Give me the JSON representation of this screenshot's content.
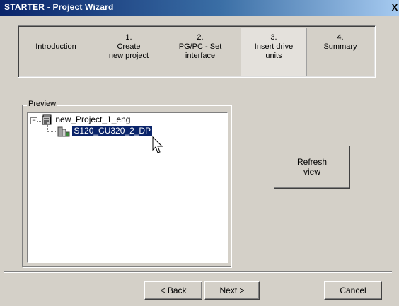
{
  "window": {
    "title": "STARTER - Project Wizard",
    "close_label": "X"
  },
  "steps": [
    {
      "number": "",
      "label": "Introduction"
    },
    {
      "number": "1.",
      "label": "Create\nnew project"
    },
    {
      "number": "2.",
      "label": "PG/PC - Set\ninterface"
    },
    {
      "number": "3.",
      "label": "Insert drive\nunits"
    },
    {
      "number": "4.",
      "label": "Summary"
    }
  ],
  "active_step": "3.",
  "preview": {
    "label": "Preview",
    "tree": {
      "root": {
        "label": "new_Project_1_eng",
        "expander": "−",
        "icon": "project-icon"
      },
      "child": {
        "label": "S120_CU320_2_DP",
        "icon": "drive-unit-icon",
        "selected": true
      }
    }
  },
  "buttons": {
    "refresh": "Refresh\nview",
    "back": "< Back",
    "next": "Next >",
    "cancel": "Cancel"
  }
}
